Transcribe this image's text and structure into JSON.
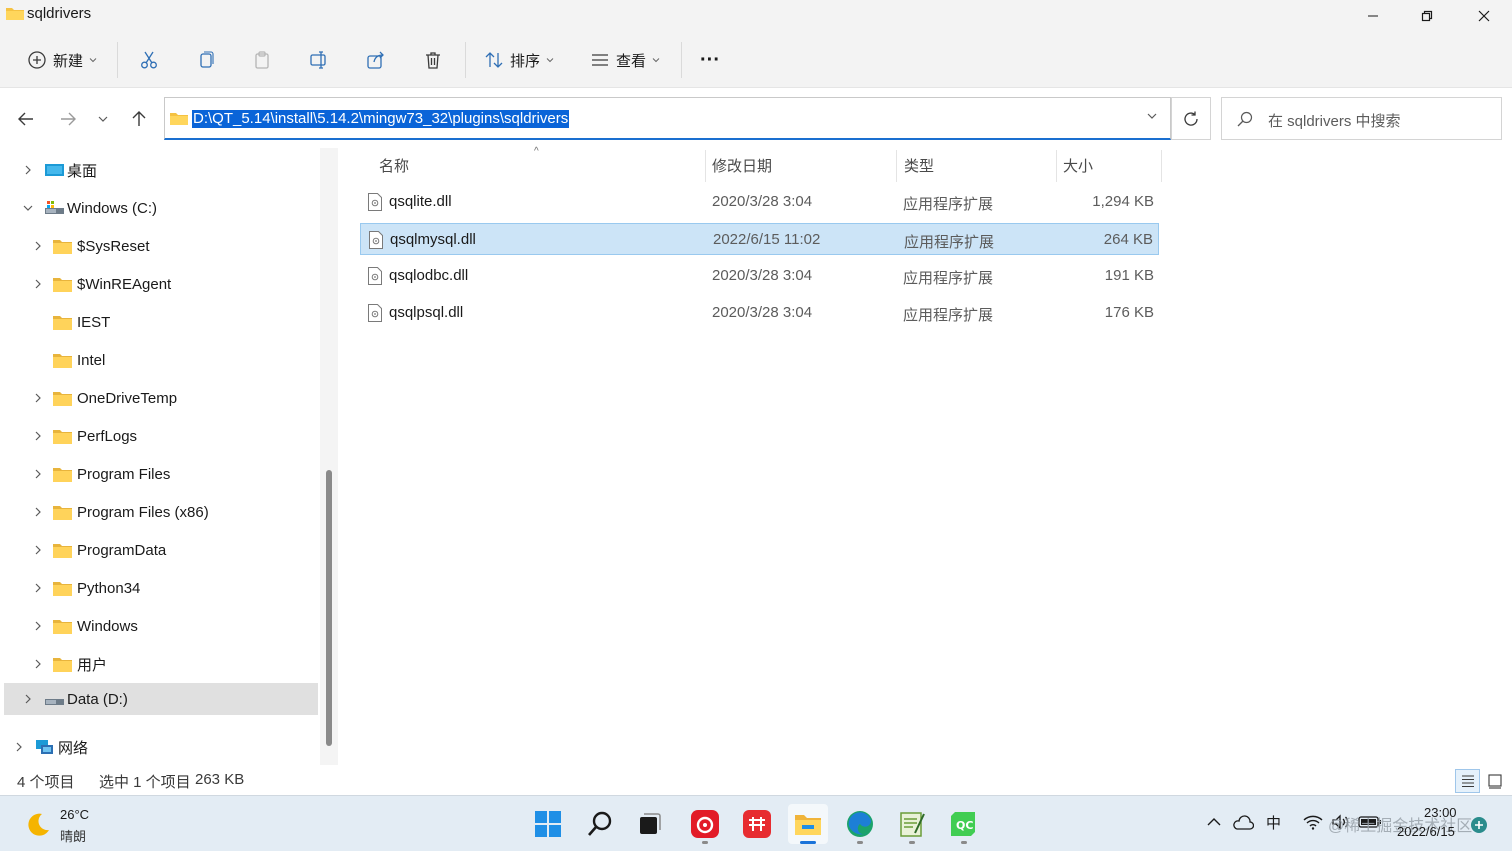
{
  "window": {
    "title": "sqldrivers",
    "controls": [
      "minimize",
      "restore",
      "close"
    ]
  },
  "toolbar": {
    "new_label": "新建",
    "sort_label": "排序",
    "view_label": "查看",
    "more_label": "···"
  },
  "address": {
    "path": "D:\\QT_5.14\\install\\5.14.2\\mingw73_32\\plugins\\sqldrivers"
  },
  "search": {
    "placeholder": "在 sqldrivers 中搜索"
  },
  "sidebar": {
    "items": [
      {
        "label": "桌面",
        "icon": "desktop-icon",
        "expand": "collapsed"
      },
      {
        "label": "Windows (C:)",
        "icon": "drive-icon",
        "expand": "expanded"
      },
      {
        "label": "$SysReset",
        "icon": "folder-icon",
        "expand": "collapsed"
      },
      {
        "label": "$WinREAgent",
        "icon": "folder-icon",
        "expand": "collapsed"
      },
      {
        "label": "IEST",
        "icon": "folder-icon",
        "expand": "none"
      },
      {
        "label": "Intel",
        "icon": "folder-icon",
        "expand": "none"
      },
      {
        "label": "OneDriveTemp",
        "icon": "folder-icon",
        "expand": "collapsed"
      },
      {
        "label": "PerfLogs",
        "icon": "folder-icon",
        "expand": "collapsed"
      },
      {
        "label": "Program Files",
        "icon": "folder-icon",
        "expand": "collapsed"
      },
      {
        "label": "Program Files (x86)",
        "icon": "folder-icon",
        "expand": "collapsed"
      },
      {
        "label": "ProgramData",
        "icon": "folder-icon",
        "expand": "collapsed"
      },
      {
        "label": "Python34",
        "icon": "folder-icon",
        "expand": "collapsed"
      },
      {
        "label": "Windows",
        "icon": "folder-icon",
        "expand": "collapsed"
      },
      {
        "label": "用户",
        "icon": "folder-icon",
        "expand": "collapsed"
      },
      {
        "label": "Data (D:)",
        "icon": "drive-icon",
        "expand": "collapsed",
        "selected": true
      },
      {
        "label": "网络",
        "icon": "network-icon",
        "expand": "collapsed"
      }
    ]
  },
  "files": {
    "columns": [
      "名称",
      "修改日期",
      "类型",
      "大小"
    ],
    "rows": [
      {
        "name": "qsqlite.dll",
        "date": "2020/3/28 3:04",
        "type": "应用程序扩展",
        "size": "1,294 KB",
        "selected": false
      },
      {
        "name": "qsqlmysql.dll",
        "date": "2022/6/15 11:02",
        "type": "应用程序扩展",
        "size": "264 KB",
        "selected": true
      },
      {
        "name": "qsqlodbc.dll",
        "date": "2020/3/28 3:04",
        "type": "应用程序扩展",
        "size": "191 KB",
        "selected": false
      },
      {
        "name": "qsqlpsql.dll",
        "date": "2020/3/28 3:04",
        "type": "应用程序扩展",
        "size": "176 KB",
        "selected": false
      }
    ]
  },
  "status": {
    "count": "4 个项目",
    "selection": "选中 1 个项目",
    "selection_size": "263 KB"
  },
  "taskbar": {
    "weather_temp": "26°C",
    "weather_desc": "晴朗",
    "ime": "中",
    "time": "23:00",
    "date": "2022/6/15",
    "watermark": "@稀土掘金技术社区"
  },
  "colors": {
    "selection": "#cce4f7",
    "accent": "#0a64d8",
    "folder": "#f5c242"
  }
}
